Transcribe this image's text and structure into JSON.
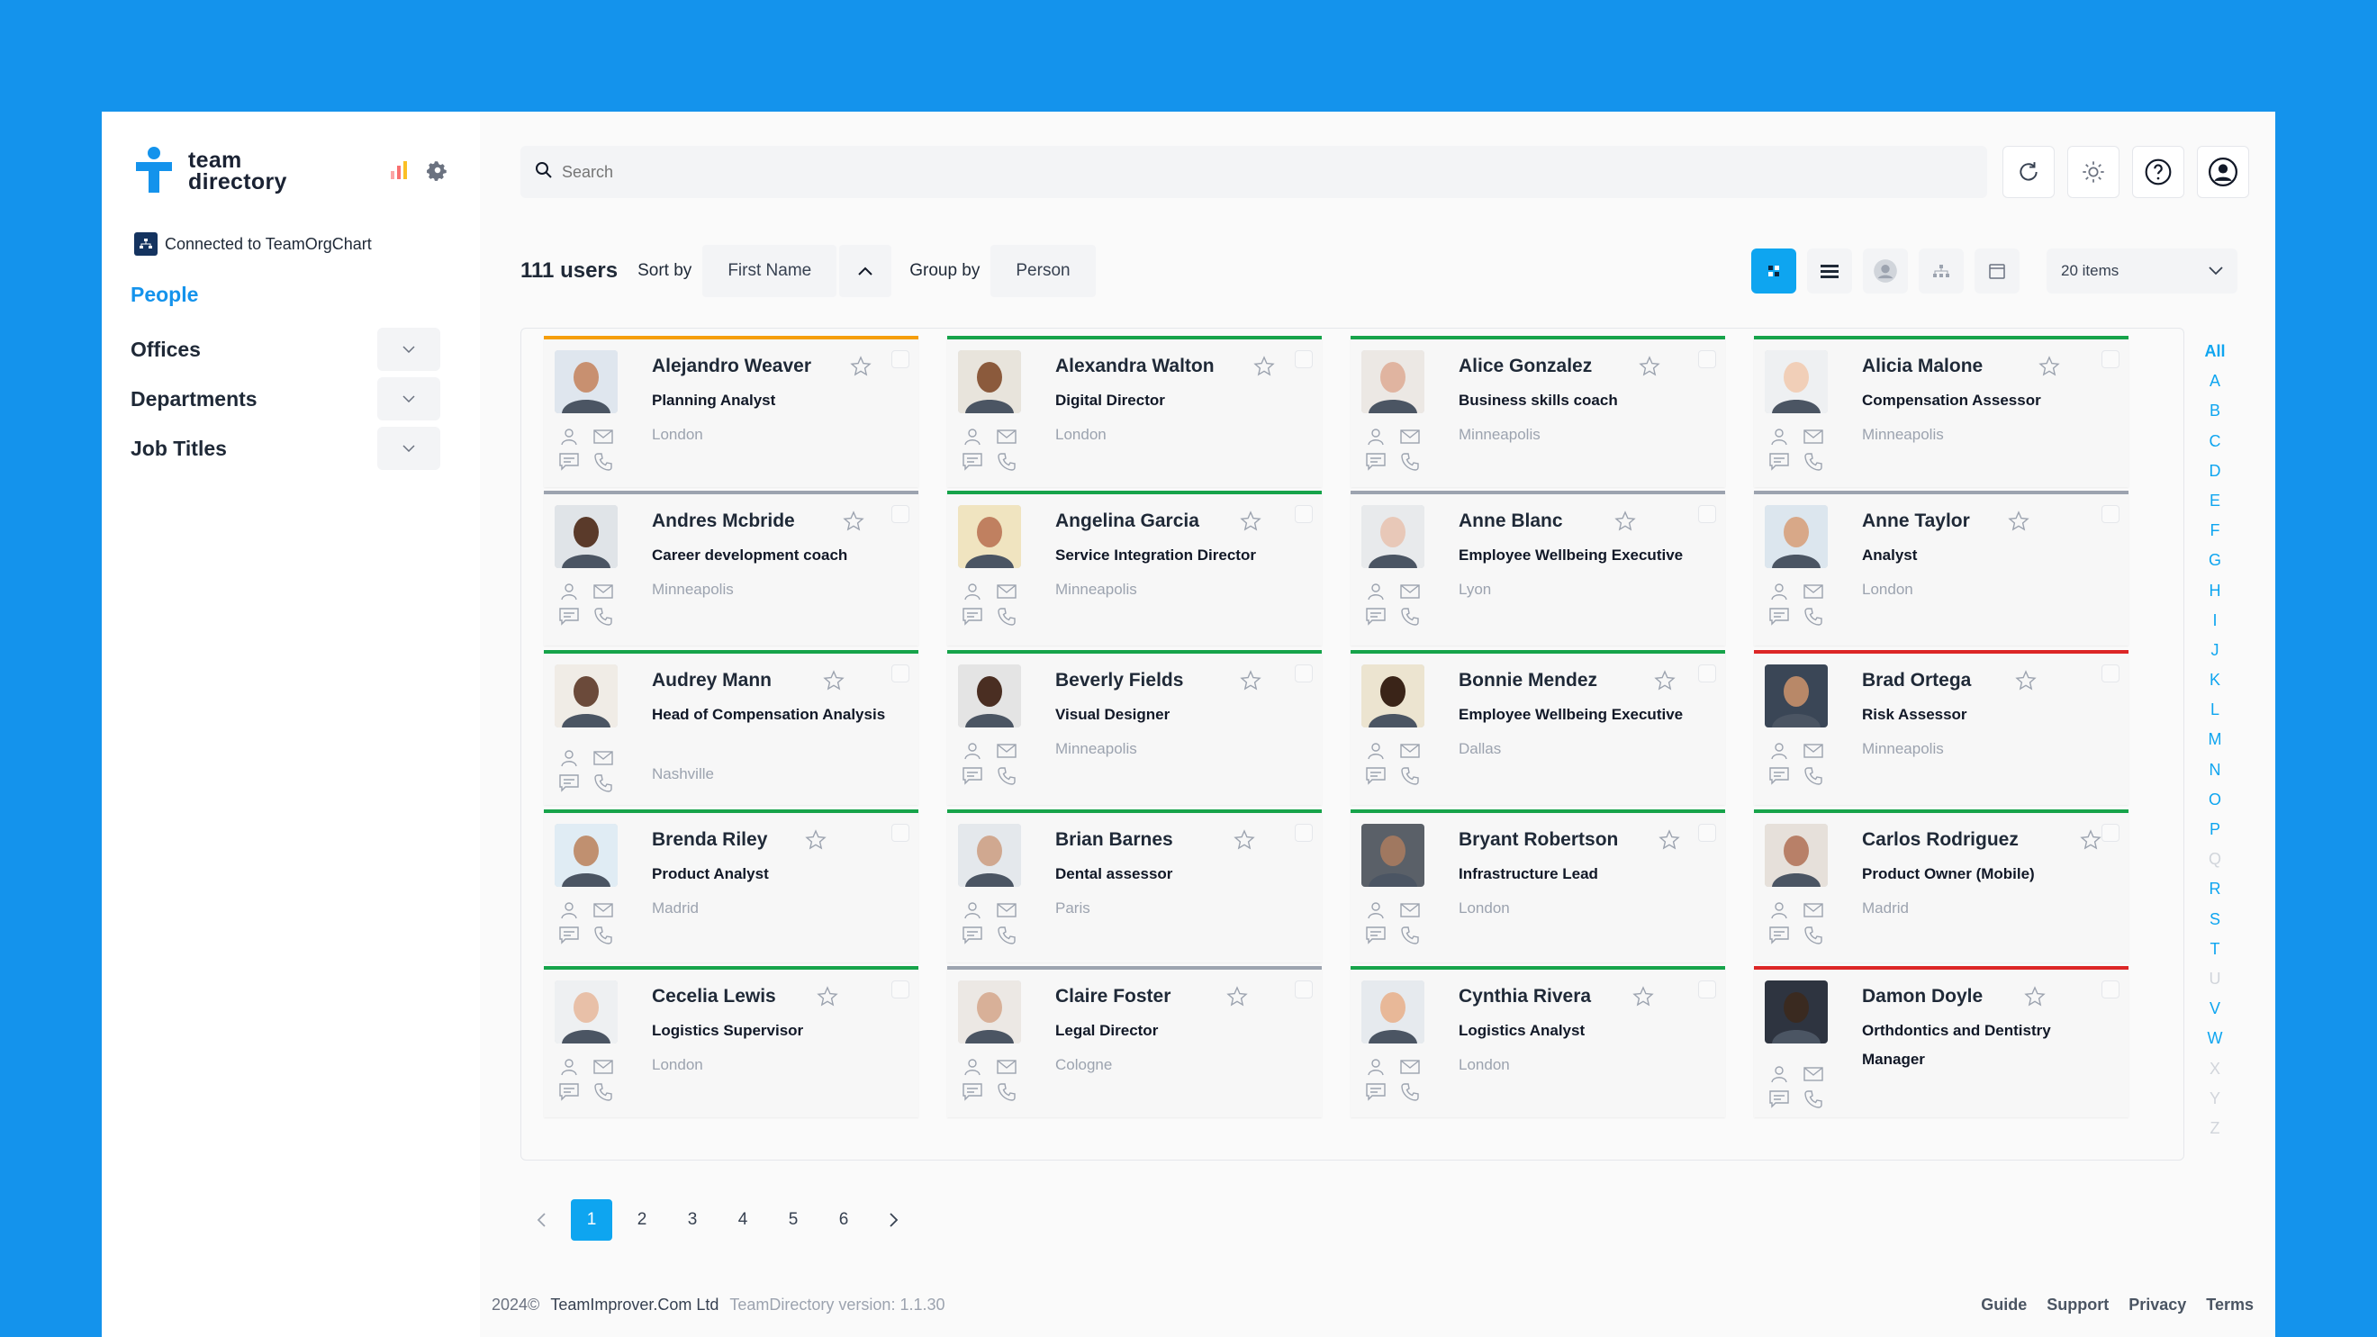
{
  "brand": {
    "line1": "team",
    "line2": "directory"
  },
  "connected": "Connected to TeamOrgChart",
  "nav": {
    "people": "People",
    "offices": "Offices",
    "departments": "Departments",
    "job_titles": "Job Titles"
  },
  "search": {
    "placeholder": "Search"
  },
  "toolbar": {
    "count": "111 users",
    "sort_label": "Sort by",
    "sort_value": "First Name",
    "group_label": "Group by",
    "group_value": "Person",
    "items": "20 items"
  },
  "colors": {
    "accent": "#0ea5f0",
    "background": "#1493EC",
    "green": "#16a34a",
    "orange": "#f59e0b",
    "gray": "#9ca3af",
    "red": "#dc2626"
  },
  "cards": [
    {
      "name": "Alejandro Weaver",
      "title": "Planning Analyst",
      "city": "London"
    },
    {
      "name": "Alexandra Walton",
      "title": "Digital Director",
      "city": "London"
    },
    {
      "name": "Alice Gonzalez",
      "title": "Business skills coach",
      "city": "Minneapolis"
    },
    {
      "name": "Alicia Malone",
      "title": "Compensation Assessor",
      "city": "Minneapolis"
    },
    {
      "name": "Andres Mcbride",
      "title": "Career development coach",
      "city": "Minneapolis"
    },
    {
      "name": "Angelina Garcia",
      "title": "Service Integration Director",
      "city": "Minneapolis"
    },
    {
      "name": "Anne Blanc",
      "title": "Employee Wellbeing Executive",
      "city": "Lyon"
    },
    {
      "name": "Anne Taylor",
      "title": "Analyst",
      "city": "London"
    },
    {
      "name": "Audrey Mann",
      "title": "Head of Compensation Analysis",
      "city": "Nashville"
    },
    {
      "name": "Beverly Fields",
      "title": "Visual Designer",
      "city": "Minneapolis"
    },
    {
      "name": "Bonnie Mendez",
      "title": "Employee Wellbeing Executive",
      "city": "Dallas"
    },
    {
      "name": "Brad Ortega",
      "title": "Risk Assessor",
      "city": "Minneapolis"
    },
    {
      "name": "Brenda Riley",
      "title": "Product Analyst",
      "city": "Madrid"
    },
    {
      "name": "Brian Barnes",
      "title": "Dental assessor",
      "city": "Paris"
    },
    {
      "name": "Bryant Robertson",
      "title": "Infrastructure Lead",
      "city": "London"
    },
    {
      "name": "Carlos Rodriguez",
      "title": "Product Owner (Mobile)",
      "city": "Madrid"
    },
    {
      "name": "Cecelia Lewis",
      "title": "Logistics Supervisor",
      "city": "London"
    },
    {
      "name": "Claire Foster",
      "title": "Legal Director",
      "city": "Cologne"
    },
    {
      "name": "Cynthia Rivera",
      "title": "Logistics Analyst",
      "city": "London"
    },
    {
      "name": "Damon Doyle",
      "title": "Orthdontics and Dentistry Manager",
      "city": ""
    }
  ],
  "alphabet": [
    "All",
    "A",
    "B",
    "C",
    "D",
    "E",
    "F",
    "G",
    "H",
    "I",
    "J",
    "K",
    "L",
    "M",
    "N",
    "O",
    "P",
    "Q",
    "R",
    "S",
    "T",
    "U",
    "V",
    "W",
    "X",
    "Y",
    "Z"
  ],
  "pages": [
    "1",
    "2",
    "3",
    "4",
    "5",
    "6"
  ],
  "footer": {
    "copyright": "2024©",
    "company": "TeamImprover.Com Ltd",
    "version": "TeamDirectory version: 1.1.30",
    "links": [
      "Guide",
      "Support",
      "Privacy",
      "Terms"
    ]
  }
}
